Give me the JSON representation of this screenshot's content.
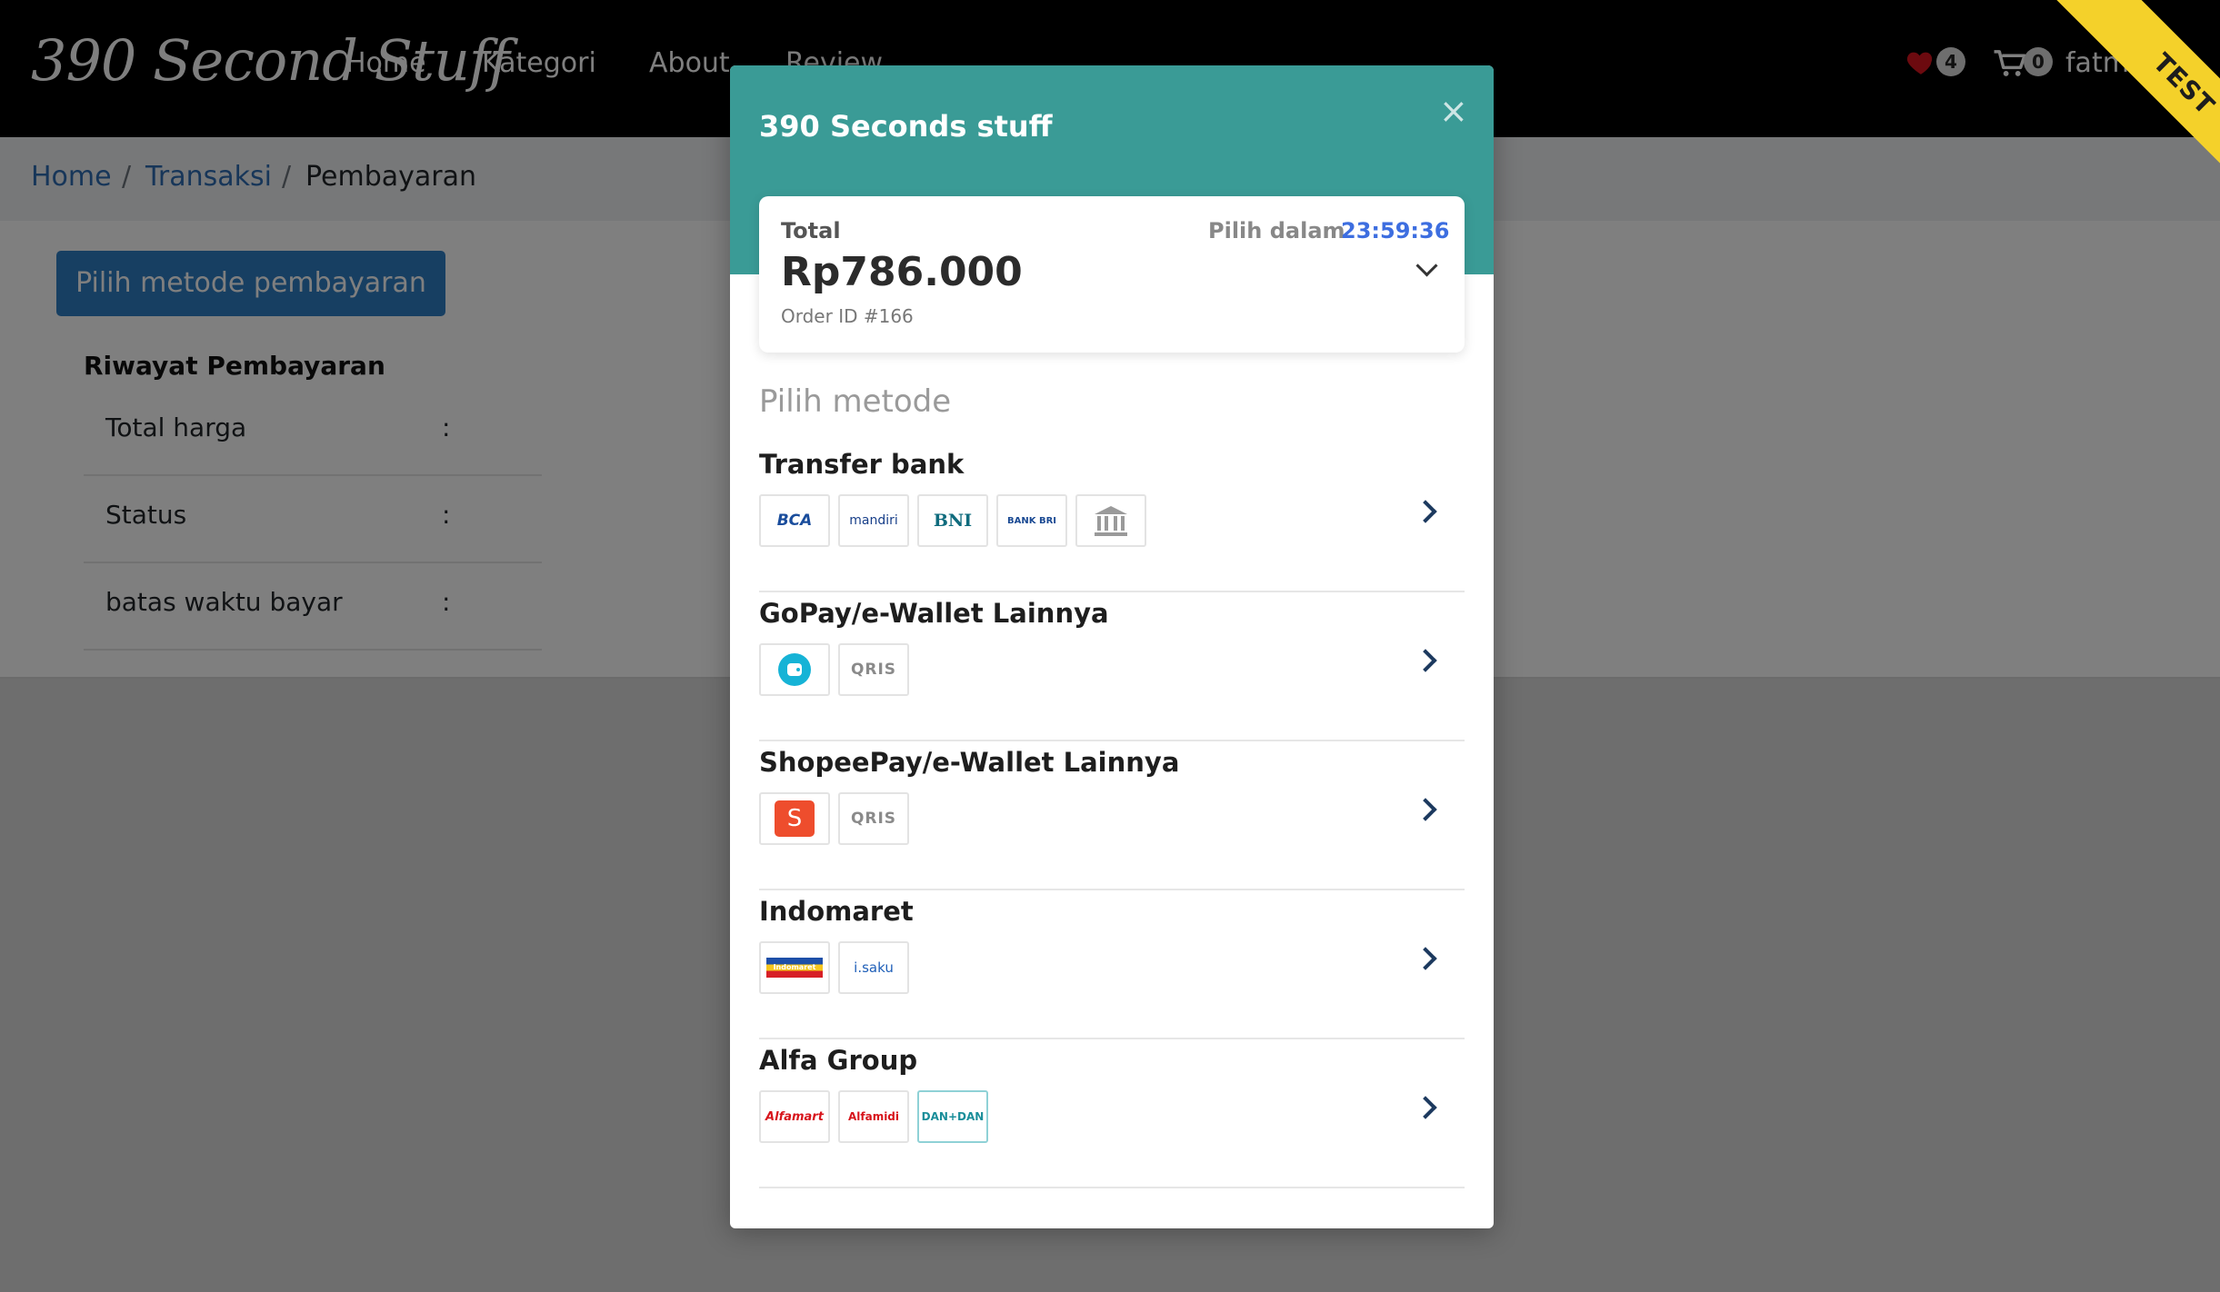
{
  "navbar": {
    "brand": "390 Second Stuff",
    "links": [
      "Home",
      "Kategori",
      "About",
      "Review"
    ],
    "wishlist_count": "4",
    "cart_count": "0",
    "user": "fatma",
    "ribbon": "TEST"
  },
  "breadcrumb": {
    "home": "Home",
    "sep": "/",
    "transaksi": "Transaksi",
    "current": "Pembayaran"
  },
  "main": {
    "pay_button": "Pilih metode pembayaran",
    "history_title": "Riwayat Pembayaran",
    "rows": [
      {
        "label": "Total harga",
        "colon": ":"
      },
      {
        "label": "Status",
        "colon": ":"
      },
      {
        "label": "batas waktu bayar",
        "colon": ":"
      }
    ]
  },
  "modal": {
    "title": "390 Seconds stuff",
    "close": "×",
    "total_label": "Total",
    "amount": "Rp786.000",
    "order_id": "Order ID #166",
    "deadline_label": "Pilih dalam",
    "countdown": "23:59:36",
    "pick_title": "Pilih metode",
    "methods": [
      {
        "name": "Transfer bank",
        "logos": [
          "BCA",
          "mandiri",
          "BNI",
          "BANK BRI",
          "bank-icon"
        ]
      },
      {
        "name": "GoPay/e-Wallet Lainnya",
        "logos": [
          "gopay-icon",
          "QRIS"
        ]
      },
      {
        "name": "ShopeePay/e-Wallet Lainnya",
        "logos": [
          "S",
          "QRIS"
        ]
      },
      {
        "name": "Indomaret",
        "logos": [
          "Indomaret",
          "i.saku"
        ]
      },
      {
        "name": "Alfa Group",
        "logos": [
          "Alfamart",
          "Alfamidi",
          "DAN+DAN"
        ]
      }
    ]
  },
  "colors": {
    "modal_header": "#3a9b96",
    "primary_button": "#2f7ec5",
    "countdown": "#3d6ee0",
    "ribbon": "#f4d12a"
  }
}
